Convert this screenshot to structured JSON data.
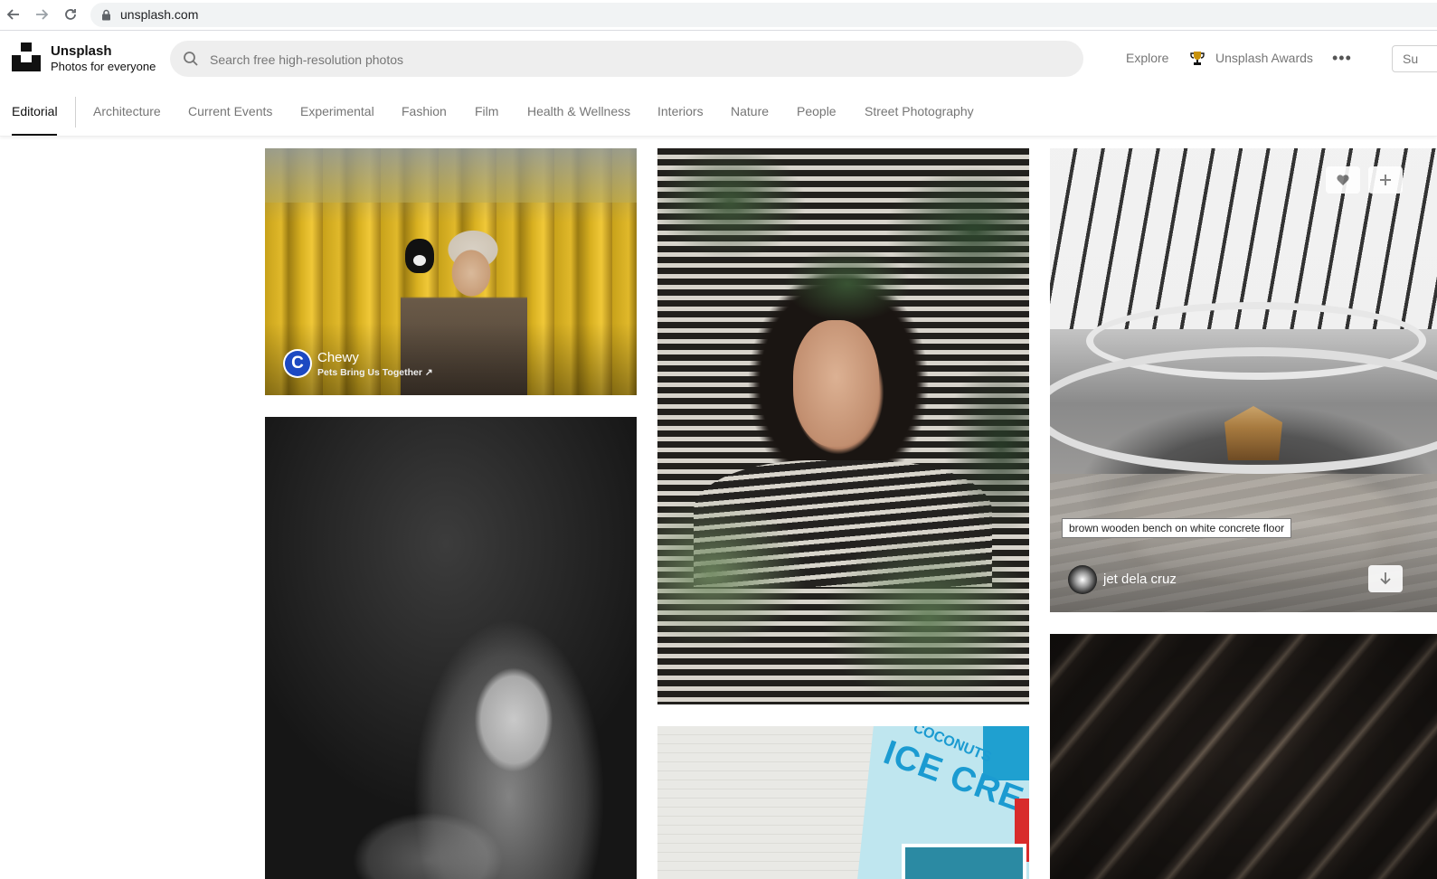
{
  "browser": {
    "url": "unsplash.com"
  },
  "header": {
    "brand_name": "Unsplash",
    "brand_tagline": "Photos for everyone",
    "search_placeholder": "Search free high-resolution photos",
    "nav": {
      "explore": "Explore",
      "awards": "Unsplash Awards",
      "more": "•••",
      "submit": "Su"
    }
  },
  "tabs": {
    "active": "Editorial",
    "items": [
      "Architecture",
      "Current Events",
      "Experimental",
      "Fashion",
      "Film",
      "Health & Wellness",
      "Interiors",
      "Nature",
      "People",
      "Street Photography"
    ]
  },
  "photos": {
    "sponsored": {
      "name": "Chewy",
      "tagline": "Pets Bring Us Together ↗",
      "avatar_letter": "C",
      "avatar_color": "#1c49c2"
    },
    "mall": {
      "tooltip": "brown wooden bench on white concrete floor",
      "author": "jet dela cruz"
    },
    "icecream": {
      "sign_small": "COCONUTS",
      "sign_big": "ICE CREAM"
    }
  },
  "icons": [
    "back-arrow-icon",
    "forward-arrow-icon",
    "reload-icon",
    "lock-icon",
    "search-icon",
    "trophy-icon",
    "heart-icon",
    "plus-icon",
    "download-icon"
  ]
}
